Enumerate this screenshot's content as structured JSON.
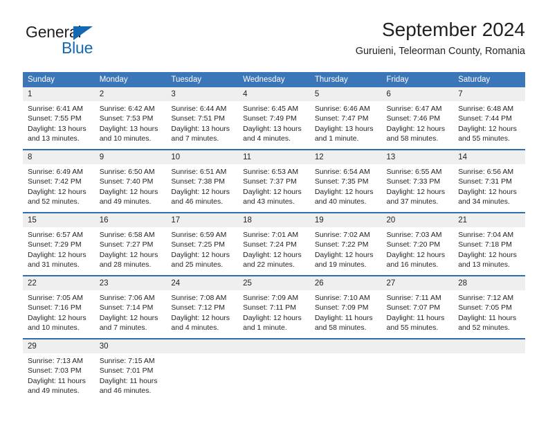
{
  "logo": {
    "word_top": "General",
    "word_bottom": "Blue",
    "triangle_icon": "blue-triangle-icon",
    "accent_color": "#1268b3"
  },
  "header": {
    "month_title": "September 2024",
    "location": "Guruieni, Teleorman County, Romania"
  },
  "theme": {
    "header_blue": "#3a76b8",
    "separator_blue": "#2f6cae",
    "daynum_band": "#efefef",
    "text": "#231f20"
  },
  "calendar": {
    "weekday_headers": [
      "Sunday",
      "Monday",
      "Tuesday",
      "Wednesday",
      "Thursday",
      "Friday",
      "Saturday"
    ],
    "weeks": [
      [
        {
          "day": "1",
          "sunrise": "Sunrise: 6:41 AM",
          "sunset": "Sunset: 7:55 PM",
          "daylight_1": "Daylight: 13 hours",
          "daylight_2": "and 13 minutes."
        },
        {
          "day": "2",
          "sunrise": "Sunrise: 6:42 AM",
          "sunset": "Sunset: 7:53 PM",
          "daylight_1": "Daylight: 13 hours",
          "daylight_2": "and 10 minutes."
        },
        {
          "day": "3",
          "sunrise": "Sunrise: 6:44 AM",
          "sunset": "Sunset: 7:51 PM",
          "daylight_1": "Daylight: 13 hours",
          "daylight_2": "and 7 minutes."
        },
        {
          "day": "4",
          "sunrise": "Sunrise: 6:45 AM",
          "sunset": "Sunset: 7:49 PM",
          "daylight_1": "Daylight: 13 hours",
          "daylight_2": "and 4 minutes."
        },
        {
          "day": "5",
          "sunrise": "Sunrise: 6:46 AM",
          "sunset": "Sunset: 7:47 PM",
          "daylight_1": "Daylight: 13 hours",
          "daylight_2": "and 1 minute."
        },
        {
          "day": "6",
          "sunrise": "Sunrise: 6:47 AM",
          "sunset": "Sunset: 7:46 PM",
          "daylight_1": "Daylight: 12 hours",
          "daylight_2": "and 58 minutes."
        },
        {
          "day": "7",
          "sunrise": "Sunrise: 6:48 AM",
          "sunset": "Sunset: 7:44 PM",
          "daylight_1": "Daylight: 12 hours",
          "daylight_2": "and 55 minutes."
        }
      ],
      [
        {
          "day": "8",
          "sunrise": "Sunrise: 6:49 AM",
          "sunset": "Sunset: 7:42 PM",
          "daylight_1": "Daylight: 12 hours",
          "daylight_2": "and 52 minutes."
        },
        {
          "day": "9",
          "sunrise": "Sunrise: 6:50 AM",
          "sunset": "Sunset: 7:40 PM",
          "daylight_1": "Daylight: 12 hours",
          "daylight_2": "and 49 minutes."
        },
        {
          "day": "10",
          "sunrise": "Sunrise: 6:51 AM",
          "sunset": "Sunset: 7:38 PM",
          "daylight_1": "Daylight: 12 hours",
          "daylight_2": "and 46 minutes."
        },
        {
          "day": "11",
          "sunrise": "Sunrise: 6:53 AM",
          "sunset": "Sunset: 7:37 PM",
          "daylight_1": "Daylight: 12 hours",
          "daylight_2": "and 43 minutes."
        },
        {
          "day": "12",
          "sunrise": "Sunrise: 6:54 AM",
          "sunset": "Sunset: 7:35 PM",
          "daylight_1": "Daylight: 12 hours",
          "daylight_2": "and 40 minutes."
        },
        {
          "day": "13",
          "sunrise": "Sunrise: 6:55 AM",
          "sunset": "Sunset: 7:33 PM",
          "daylight_1": "Daylight: 12 hours",
          "daylight_2": "and 37 minutes."
        },
        {
          "day": "14",
          "sunrise": "Sunrise: 6:56 AM",
          "sunset": "Sunset: 7:31 PM",
          "daylight_1": "Daylight: 12 hours",
          "daylight_2": "and 34 minutes."
        }
      ],
      [
        {
          "day": "15",
          "sunrise": "Sunrise: 6:57 AM",
          "sunset": "Sunset: 7:29 PM",
          "daylight_1": "Daylight: 12 hours",
          "daylight_2": "and 31 minutes."
        },
        {
          "day": "16",
          "sunrise": "Sunrise: 6:58 AM",
          "sunset": "Sunset: 7:27 PM",
          "daylight_1": "Daylight: 12 hours",
          "daylight_2": "and 28 minutes."
        },
        {
          "day": "17",
          "sunrise": "Sunrise: 6:59 AM",
          "sunset": "Sunset: 7:25 PM",
          "daylight_1": "Daylight: 12 hours",
          "daylight_2": "and 25 minutes."
        },
        {
          "day": "18",
          "sunrise": "Sunrise: 7:01 AM",
          "sunset": "Sunset: 7:24 PM",
          "daylight_1": "Daylight: 12 hours",
          "daylight_2": "and 22 minutes."
        },
        {
          "day": "19",
          "sunrise": "Sunrise: 7:02 AM",
          "sunset": "Sunset: 7:22 PM",
          "daylight_1": "Daylight: 12 hours",
          "daylight_2": "and 19 minutes."
        },
        {
          "day": "20",
          "sunrise": "Sunrise: 7:03 AM",
          "sunset": "Sunset: 7:20 PM",
          "daylight_1": "Daylight: 12 hours",
          "daylight_2": "and 16 minutes."
        },
        {
          "day": "21",
          "sunrise": "Sunrise: 7:04 AM",
          "sunset": "Sunset: 7:18 PM",
          "daylight_1": "Daylight: 12 hours",
          "daylight_2": "and 13 minutes."
        }
      ],
      [
        {
          "day": "22",
          "sunrise": "Sunrise: 7:05 AM",
          "sunset": "Sunset: 7:16 PM",
          "daylight_1": "Daylight: 12 hours",
          "daylight_2": "and 10 minutes."
        },
        {
          "day": "23",
          "sunrise": "Sunrise: 7:06 AM",
          "sunset": "Sunset: 7:14 PM",
          "daylight_1": "Daylight: 12 hours",
          "daylight_2": "and 7 minutes."
        },
        {
          "day": "24",
          "sunrise": "Sunrise: 7:08 AM",
          "sunset": "Sunset: 7:12 PM",
          "daylight_1": "Daylight: 12 hours",
          "daylight_2": "and 4 minutes."
        },
        {
          "day": "25",
          "sunrise": "Sunrise: 7:09 AM",
          "sunset": "Sunset: 7:11 PM",
          "daylight_1": "Daylight: 12 hours",
          "daylight_2": "and 1 minute."
        },
        {
          "day": "26",
          "sunrise": "Sunrise: 7:10 AM",
          "sunset": "Sunset: 7:09 PM",
          "daylight_1": "Daylight: 11 hours",
          "daylight_2": "and 58 minutes."
        },
        {
          "day": "27",
          "sunrise": "Sunrise: 7:11 AM",
          "sunset": "Sunset: 7:07 PM",
          "daylight_1": "Daylight: 11 hours",
          "daylight_2": "and 55 minutes."
        },
        {
          "day": "28",
          "sunrise": "Sunrise: 7:12 AM",
          "sunset": "Sunset: 7:05 PM",
          "daylight_1": "Daylight: 11 hours",
          "daylight_2": "and 52 minutes."
        }
      ],
      [
        {
          "day": "29",
          "sunrise": "Sunrise: 7:13 AM",
          "sunset": "Sunset: 7:03 PM",
          "daylight_1": "Daylight: 11 hours",
          "daylight_2": "and 49 minutes."
        },
        {
          "day": "30",
          "sunrise": "Sunrise: 7:15 AM",
          "sunset": "Sunset: 7:01 PM",
          "daylight_1": "Daylight: 11 hours",
          "daylight_2": "and 46 minutes."
        },
        {
          "day": "",
          "sunrise": "",
          "sunset": "",
          "daylight_1": "",
          "daylight_2": ""
        },
        {
          "day": "",
          "sunrise": "",
          "sunset": "",
          "daylight_1": "",
          "daylight_2": ""
        },
        {
          "day": "",
          "sunrise": "",
          "sunset": "",
          "daylight_1": "",
          "daylight_2": ""
        },
        {
          "day": "",
          "sunrise": "",
          "sunset": "",
          "daylight_1": "",
          "daylight_2": ""
        },
        {
          "day": "",
          "sunrise": "",
          "sunset": "",
          "daylight_1": "",
          "daylight_2": ""
        }
      ]
    ]
  }
}
